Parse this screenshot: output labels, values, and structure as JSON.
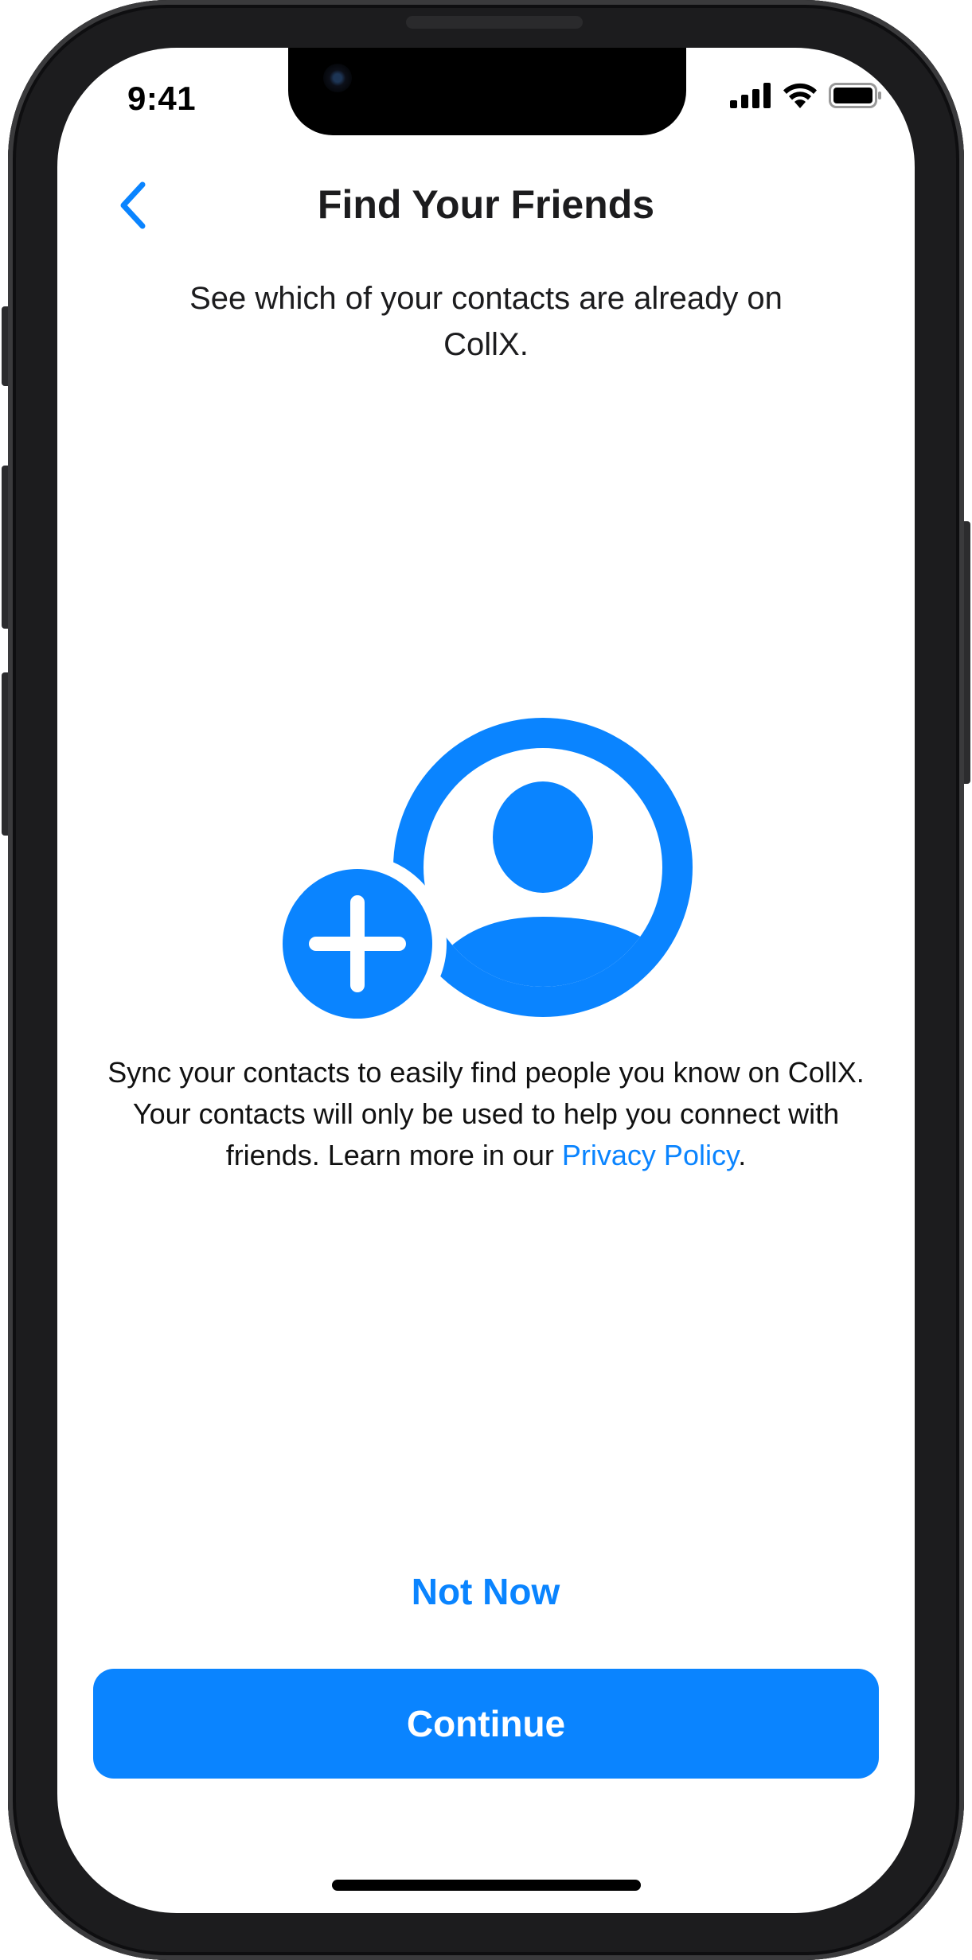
{
  "status_bar": {
    "time": "9:41",
    "icons": [
      "cellular-signal-icon",
      "wifi-icon",
      "battery-icon"
    ]
  },
  "nav": {
    "back_icon": "chevron-left-icon",
    "title": "Find Your Friends"
  },
  "header": {
    "subtitle": "See which of your contacts are already on CollX."
  },
  "illustration": {
    "icon": "person-add-icon"
  },
  "body": {
    "description_prefix": "Sync your contacts to easily find people you know on CollX. Your contacts will only be used to help you connect with friends. Learn more in our ",
    "privacy_link": "Privacy Policy",
    "description_suffix": "."
  },
  "actions": {
    "secondary_label": "Not Now",
    "primary_label": "Continue"
  },
  "colors": {
    "accent": "#0a84ff",
    "text": "#1c1c1e",
    "background": "#ffffff",
    "frame": "#1c1c1e"
  }
}
